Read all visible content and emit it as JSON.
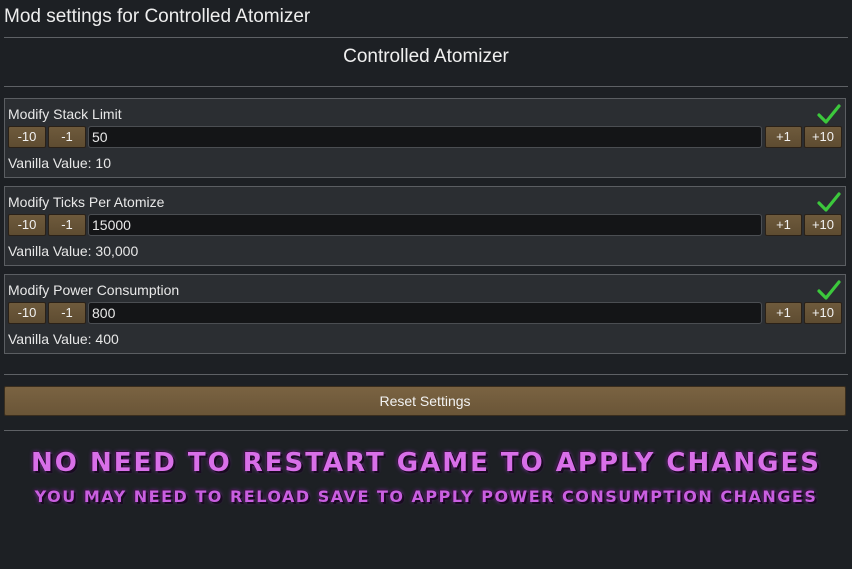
{
  "window": {
    "title": "Mod settings for Controlled Atomizer"
  },
  "mod": {
    "name": "Controlled Atomizer"
  },
  "settings": [
    {
      "label": "Modify Stack Limit",
      "value": "50",
      "vanilla": "Vanilla Value: 10",
      "buttons": {
        "minus10": "-10",
        "minus1": "-1",
        "plus1": "+1",
        "plus10": "+10"
      }
    },
    {
      "label": "Modify Ticks Per Atomize",
      "value": "15000",
      "vanilla": "Vanilla Value: 30,000",
      "buttons": {
        "minus10": "-10",
        "minus1": "-1",
        "plus1": "+1",
        "plus10": "+10"
      }
    },
    {
      "label": "Modify Power Consumption",
      "value": "800",
      "vanilla": "Vanilla Value: 400",
      "buttons": {
        "minus10": "-10",
        "minus1": "-1",
        "plus1": "+1",
        "plus10": "+10"
      }
    }
  ],
  "reset": {
    "label": "Reset Settings"
  },
  "banner": {
    "line1": "NO NEED TO RESTART GAME TO APPLY CHANGES",
    "line2": "YOU MAY NEED TO RELOAD SAVE TO APPLY POWER CONSUMPTION CHANGES"
  },
  "icons": {
    "confirm": "checkmark-icon"
  },
  "colors": {
    "check": "#3cc83c",
    "button": "#6a5536",
    "banner": "#d86fe8"
  }
}
